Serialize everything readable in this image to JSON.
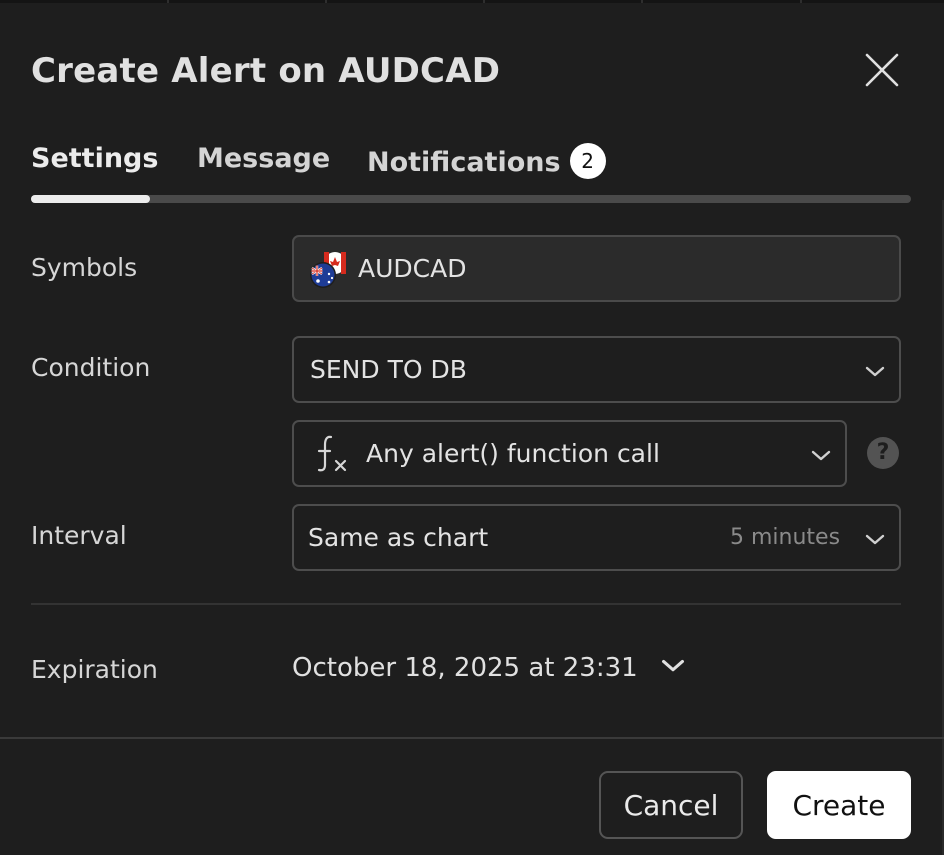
{
  "dialog": {
    "title": "Create Alert on AUDCAD",
    "close_icon": "close-icon"
  },
  "tabs": [
    {
      "label": "Settings",
      "active": true
    },
    {
      "label": "Message",
      "active": false
    },
    {
      "label": "Notifications",
      "badge": "2",
      "active": false
    }
  ],
  "settings": {
    "symbols": {
      "label": "Symbols",
      "value": "AUDCAD",
      "icon": "aud-cad-flags-icon"
    },
    "condition": {
      "label": "Condition",
      "source": "SEND TO DB",
      "trigger": "Any alert() function call",
      "trigger_icon": "function-fx-icon",
      "help_glyph": "?"
    },
    "interval": {
      "label": "Interval",
      "value": "Same as chart",
      "hint": "5 minutes"
    },
    "expiration": {
      "label": "Expiration",
      "value": "October 18, 2025 at 23:31"
    }
  },
  "footer": {
    "cancel_label": "Cancel",
    "create_label": "Create"
  },
  "colors": {
    "background": "#1e1e1e",
    "field_border": "#4d4d4d",
    "primary_button": "#ffffff",
    "tab_track": "#4a4a4a"
  }
}
